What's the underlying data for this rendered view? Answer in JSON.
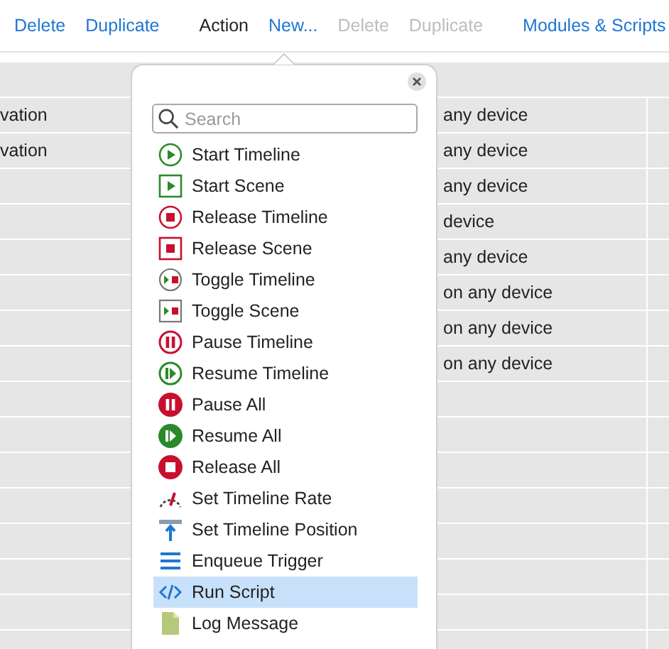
{
  "toolbar": [
    {
      "kind": "link",
      "label": "Delete",
      "disabled": false
    },
    {
      "kind": "link",
      "label": "Duplicate",
      "disabled": false
    },
    {
      "kind": "separator"
    },
    {
      "kind": "label",
      "label": "Action"
    },
    {
      "kind": "link",
      "label": "New...",
      "disabled": false
    },
    {
      "kind": "link",
      "label": "Delete",
      "disabled": true
    },
    {
      "kind": "link",
      "label": "Duplicate",
      "disabled": true
    },
    {
      "kind": "separator"
    },
    {
      "kind": "link",
      "label": "Modules & Scripts",
      "disabled": false
    }
  ],
  "table": {
    "rows": [
      {
        "column_1": "vation",
        "column_2": "any device"
      },
      {
        "column_1": "vation",
        "column_2": "any device"
      },
      {
        "column_2": "any device"
      },
      {
        "column_2": "device"
      },
      {
        "column_2": "any device"
      },
      {
        "column_2": "on any device"
      },
      {
        "column_2": "on any device"
      },
      {
        "column_2": "on any device"
      }
    ]
  },
  "popover": {
    "search": {
      "placeholder": "Search"
    },
    "items": [
      {
        "label": "Start Timeline",
        "kind": "play-circle",
        "selected": false
      },
      {
        "label": "Start Scene",
        "kind": "play-square",
        "selected": false
      },
      {
        "label": "Release Timeline",
        "kind": "stop-circle",
        "selected": false
      },
      {
        "label": "Release Scene",
        "kind": "stop-square",
        "selected": false
      },
      {
        "label": "Toggle Timeline",
        "kind": "toggle-circle",
        "selected": false
      },
      {
        "label": "Toggle Scene",
        "kind": "toggle-square",
        "selected": false
      },
      {
        "label": "Pause Timeline",
        "kind": "pause-circle",
        "selected": false
      },
      {
        "label": "Resume Timeline",
        "kind": "resume-circle",
        "selected": false
      },
      {
        "label": "Pause All",
        "kind": "pause-filled",
        "selected": false
      },
      {
        "label": "Resume All",
        "kind": "resume-filled",
        "selected": false
      },
      {
        "label": "Release All",
        "kind": "stop-filled",
        "selected": false
      },
      {
        "label": "Set Timeline Rate",
        "kind": "gauge",
        "selected": false
      },
      {
        "label": "Set Timeline Position",
        "kind": "position",
        "selected": false
      },
      {
        "label": "Enqueue Trigger",
        "kind": "queue",
        "selected": false
      },
      {
        "label": "Run Script",
        "kind": "code",
        "selected": true
      },
      {
        "label": "Log Message",
        "kind": "document",
        "selected": false
      }
    ]
  }
}
